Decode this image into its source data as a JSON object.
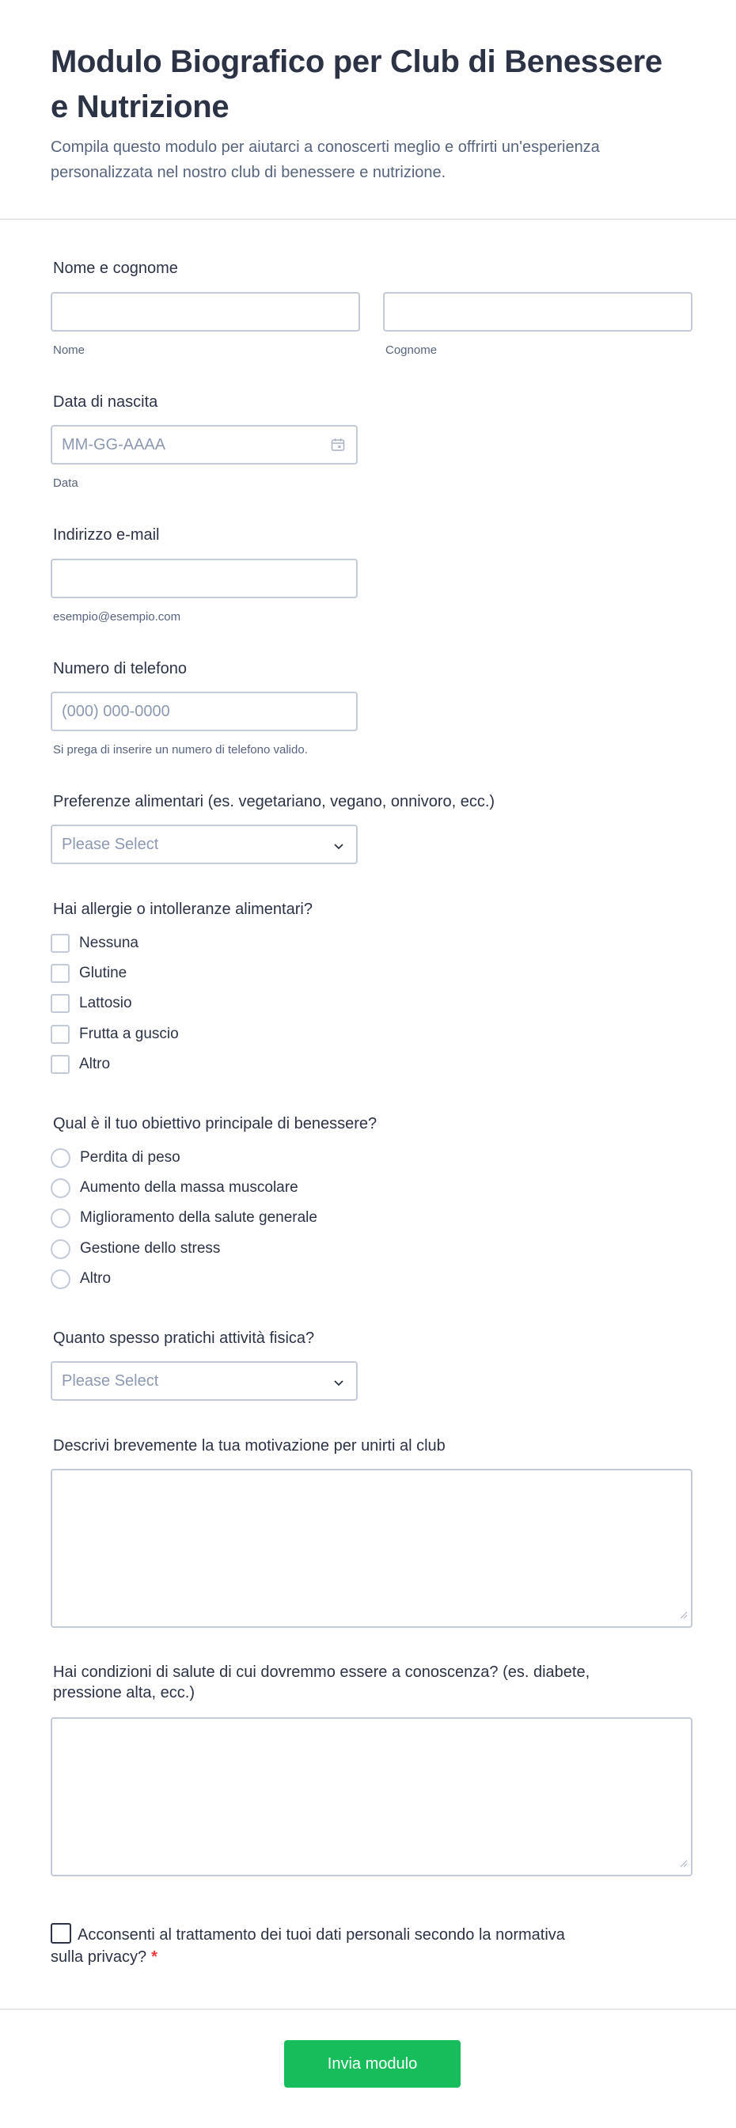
{
  "header": {
    "title": "Modulo Biografico per Club di Benessere e Nutrizione",
    "subtitle": "Compila questo modulo per aiutarci a conoscerti meglio e offrirti un'esperienza personalizzata nel nostro club di benessere e nutrizione."
  },
  "name_field": {
    "label": "Nome e cognome",
    "first_sublabel": "Nome",
    "last_sublabel": "Cognome"
  },
  "birth_field": {
    "label": "Data di nascita",
    "placeholder": "MM-GG-AAAA",
    "sublabel": "Data"
  },
  "email_field": {
    "label": "Indirizzo e-mail",
    "sublabel": "esempio@esempio.com"
  },
  "phone_field": {
    "label": "Numero di telefono",
    "placeholder": "(000) 000-0000",
    "sublabel": "Si prega di inserire un numero di telefono valido."
  },
  "diet_field": {
    "label": "Preferenze alimentari (es. vegetariano, vegano, onnivoro, ecc.)",
    "selected": "Please Select"
  },
  "allergy_field": {
    "label": "Hai allergie o intolleranze alimentari?",
    "options": [
      "Nessuna",
      "Glutine",
      "Lattosio",
      "Frutta a guscio",
      "Altro"
    ]
  },
  "goal_field": {
    "label": "Qual è il tuo obiettivo principale di benessere?",
    "options": [
      "Perdita di peso",
      "Aumento della massa muscolare",
      "Miglioramento della salute generale",
      "Gestione dello stress",
      "Altro"
    ]
  },
  "activity_field": {
    "label": "Quanto spesso pratichi attività fisica?",
    "selected": "Please Select"
  },
  "motivation_field": {
    "label": "Descrivi brevemente la tua motivazione per unirti al club"
  },
  "health_field": {
    "label_line1": "Hai condizioni di salute di cui dovremmo essere a conoscenza? (es. diabete,",
    "label_line2": "pressione alta, ecc.)"
  },
  "consent_field": {
    "label_line1": "Acconsenti al trattamento dei tuoi dati personali secondo la normativa",
    "label_line2": "sulla privacy?",
    "required_mark": "*"
  },
  "submit": {
    "label": "Invia modulo"
  },
  "colors": {
    "accent": "#18bd5b",
    "border": "#c3cad8",
    "text": "#2c3345",
    "muted": "#57647e",
    "required": "#f23a3c"
  }
}
